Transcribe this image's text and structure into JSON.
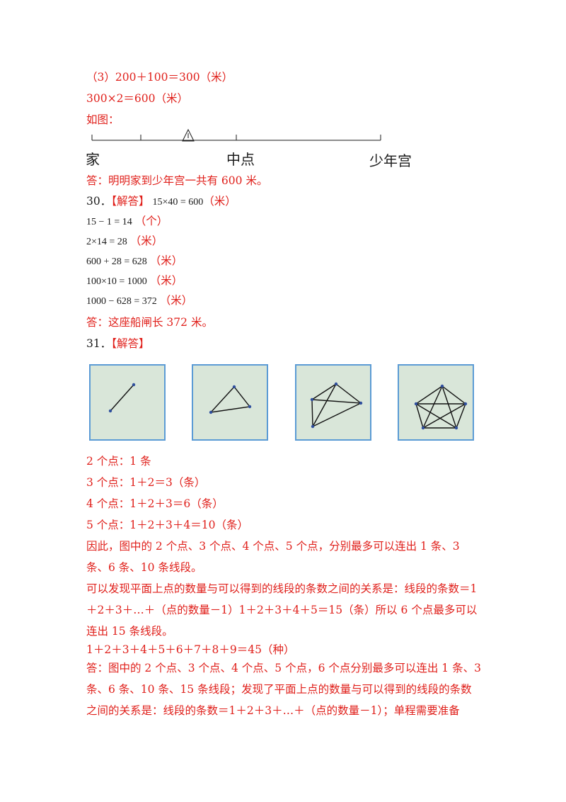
{
  "lines": {
    "l1": "（3）200＋100＝300（米）",
    "l2": "300×2＝600（米）",
    "l3": "如图：",
    "l4": "答：明明家到少年宫一共有 600 米。",
    "q30_num": "30．",
    "q30_tag": "【解答】",
    "q30_eq1": "15×40 = 600",
    "q30_u1": "（米）",
    "q30_eq2": "15 − 1 = 14",
    "q30_u2": "（个）",
    "q30_eq3": "2×14 = 28",
    "q30_u3": "（米）",
    "q30_eq4": "600 + 28 = 628",
    "q30_u4": "（米）",
    "q30_eq5": "100×10 = 1000",
    "q30_u5": "（米）",
    "q30_eq6": "1000 − 628 = 372",
    "q30_u6": "（米）",
    "q30_ans": "答：这座船闸长 372 米。",
    "q31_num": "31．",
    "q31_tag": "【解答】",
    "p2": "2 个点：1 条",
    "p3": "3 个点：1＋2＝3（条）",
    "p4": "4 个点：1＋2＋3＝6（条）",
    "p5": "5 个点：1＋2＋3＋4＝10（条）",
    "para1": "因此，图中的 2 个点、3 个点、4 个点、5 个点，分别最多可以连出 1 条、3 条、6 条、10 条线段。",
    "para2": "可以发现平面上点的数量与可以得到的线段的条数之间的关系是：线段的条数＝1＋2＋3＋…＋（点的数量－1）1＋2＋3＋4＋5＝15（条）所以 6 个点最多可以连出 15 条线段。",
    "eq_last": "1＋2＋3＋4＋5＋6＋7＋8＋9＝45（种）",
    "para3": "答：图中的 2 个点、3 个点、4 个点、5 个点，6 个点分别最多可以连出 1 条、3 条、6 条、10 条、15 条线段；发现了平面上点的数量与可以得到的线段的条数之间的关系是：线段的条数＝1＋2＋3＋…＋（点的数量－1）；单程需要准备"
  },
  "number_line": {
    "home": "家",
    "middle": "中点",
    "palace": "少年宫"
  },
  "colors": {
    "answer_red": "#e0201b",
    "box_fill": "#d9e6d9",
    "box_border": "#5b9bd5"
  }
}
